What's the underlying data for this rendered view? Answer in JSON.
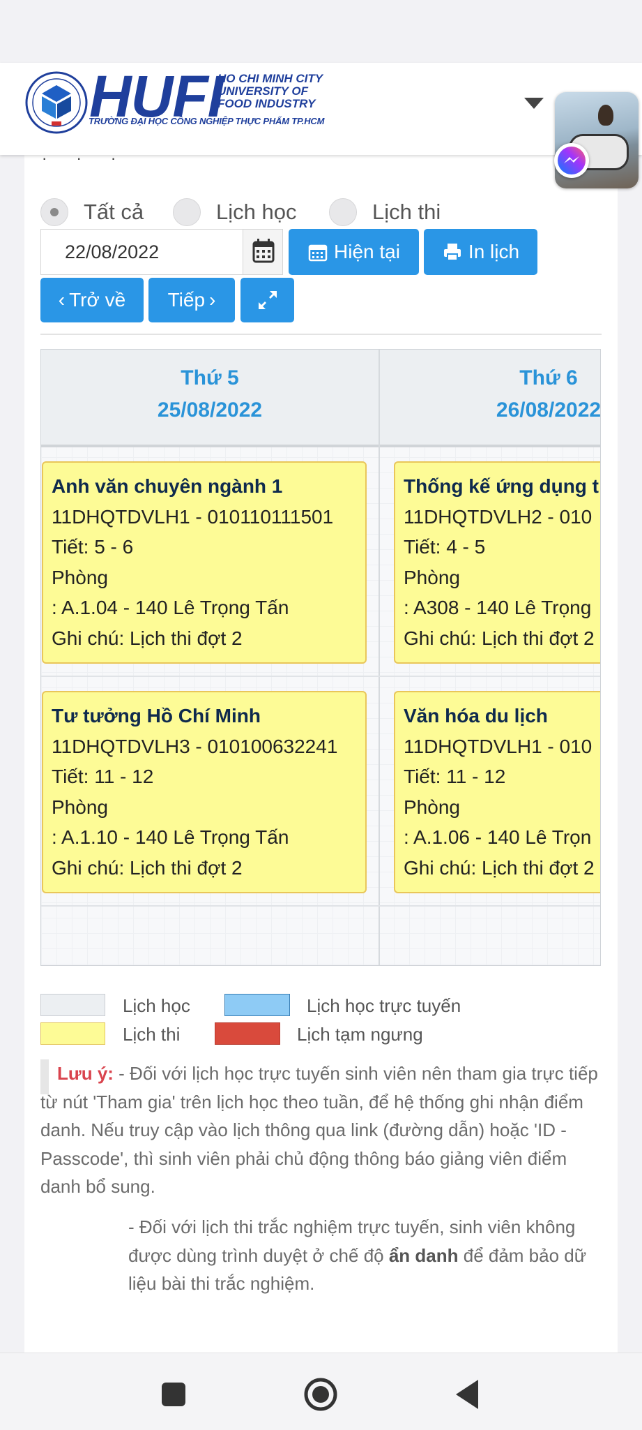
{
  "header": {
    "logo_text": "HUFI",
    "logo_subtitle": "HO CHI MINH CITY UNIVERSITY OF FOOD INDUSTRY",
    "logo_tagline": "TRƯỜNG ĐẠI HỌC CÔNG NGHIỆP THỰC PHẨM TP.HCM"
  },
  "filters": {
    "all": "Tất cả",
    "study": "Lịch học",
    "exam": "Lịch thi",
    "selected": "Tất cả"
  },
  "toolbar": {
    "date_value": "22/08/2022",
    "current_label": "Hiện tại",
    "print_label": "In lịch",
    "back_label": "Trở về",
    "next_label": "Tiếp"
  },
  "days": [
    {
      "weekday": "Thứ 5",
      "date": "25/08/2022"
    },
    {
      "weekday": "Thứ 6",
      "date": "26/08/2022"
    }
  ],
  "events": [
    {
      "title": "Anh văn chuyên ngành 1",
      "code": "11DHQTDVLH1 - 010110111501",
      "period": "Tiết: 5 - 6",
      "room_label": "Phòng",
      "room": ": A.1.04 - 140 Lê Trọng Tấn",
      "note": "Ghi chú: Lịch thi đợt 2"
    },
    {
      "title": "Thống kế ứng dụng t",
      "code": "11DHQTDVLH2 - 010",
      "period": "Tiết: 4 - 5",
      "room_label": "Phòng",
      "room": ": A308 - 140 Lê Trọng",
      "note": "Ghi chú: Lịch thi đợt 2"
    },
    {
      "title": "Tư tưởng Hồ Chí Minh",
      "code": "11DHQTDVLH3 - 010100632241",
      "period": "Tiết: 11 - 12",
      "room_label": "Phòng",
      "room": ": A.1.10 - 140 Lê Trọng Tấn",
      "note": "Ghi chú: Lịch thi đợt 2"
    },
    {
      "title": "Văn hóa du lịch",
      "code": "11DHQTDVLH1 - 010",
      "period": "Tiết: 11 - 12",
      "room_label": "Phòng",
      "room": ": A.1.06 - 140 Lê Trọn",
      "note": "Ghi chú: Lịch thi đợt 2"
    }
  ],
  "legend": {
    "study": "Lịch học",
    "online": "Lịch học trực tuyến",
    "exam": "Lịch thi",
    "suspended": "Lịch tạm ngưng",
    "colors": {
      "study": "#eceff2",
      "online": "#8ecbf5",
      "exam": "#fdfb96",
      "suspended": "#d94a3c"
    }
  },
  "notes": {
    "label": "Lưu ý:",
    "text1": " - Đối với lịch học trực tuyến sinh viên nên tham gia trực tiếp từ nút 'Tham gia' trên lịch học theo tuần, để hệ thống ghi nhận điểm danh. Nếu truy cập vào lịch thông qua link (đường dẫn) hoặc 'ID - Passcode', thì sinh viên phải chủ động thông báo giảng viên điểm danh bổ sung.",
    "text2_a": "- Đối với lịch thi trắc nghiệm trực tuyến, sinh viên không được dùng trình duyệt ở chế độ ",
    "text2_b": "ẩn danh",
    "text2_c": " để đảm bảo dữ liệu bài thi trắc nghiệm."
  },
  "colors": {
    "accent": "#2a96e6",
    "brand": "#1f3f9c"
  }
}
